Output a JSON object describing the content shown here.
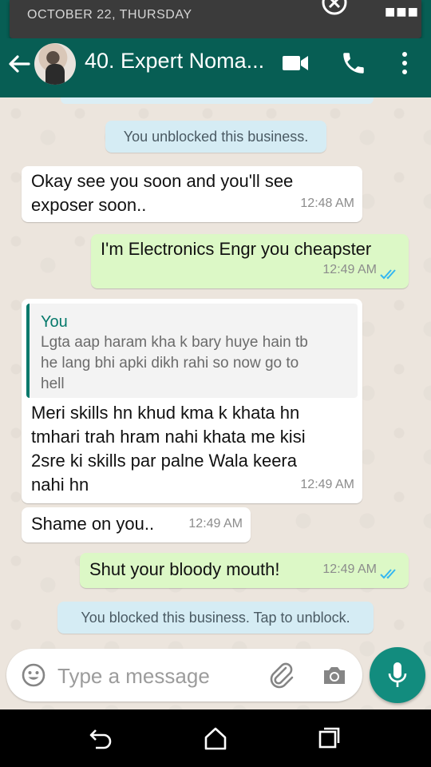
{
  "notification": {
    "date": "OCTOBER 22, THURSDAY"
  },
  "header": {
    "title": "40. Expert Noma..."
  },
  "colors": {
    "header": "#075e54",
    "outgoing": "#dcf8c6",
    "incoming": "#ffffff",
    "system": "#d5ecf4",
    "read_ticks": "#34b7f1",
    "fab": "#128c7e"
  },
  "messages": [
    {
      "type": "system",
      "text": "You unblocked this business."
    },
    {
      "type": "incoming",
      "text_lines": [
        "Okay see you soon and you'll see",
        "exposer soon.."
      ],
      "time": "12:48 AM"
    },
    {
      "type": "outgoing",
      "text": "I'm Electronics Engr you cheapster",
      "time": "12:49 AM",
      "status": "read"
    },
    {
      "type": "incoming",
      "quote": {
        "author": "You",
        "text_lines": [
          "Lgta aap haram kha k bary huye hain tb",
          "he lang bhi apki dikh rahi so now go to",
          "hell"
        ]
      },
      "text_lines": [
        "Meri skills hn khud kma k khata hn",
        "tmhari trah hram nahi khata me kisi",
        "2sre ki skills par palne Wala keera",
        "nahi hn"
      ],
      "time": "12:49 AM"
    },
    {
      "type": "incoming",
      "text": "Shame on you..",
      "time": "12:49 AM"
    },
    {
      "type": "outgoing",
      "text": "Shut your bloody mouth!",
      "time": "12:49 AM",
      "status": "read"
    },
    {
      "type": "system",
      "text": "You blocked this business. Tap to unblock."
    }
  ],
  "input": {
    "placeholder": "Type a message"
  },
  "icons": [
    "back-arrow-icon",
    "video-call-icon",
    "phone-icon",
    "more-vert-icon",
    "emoji-icon",
    "attach-icon",
    "camera-icon",
    "mic-icon",
    "nav-back-icon",
    "nav-home-icon",
    "nav-recents-icon",
    "close-icon"
  ]
}
